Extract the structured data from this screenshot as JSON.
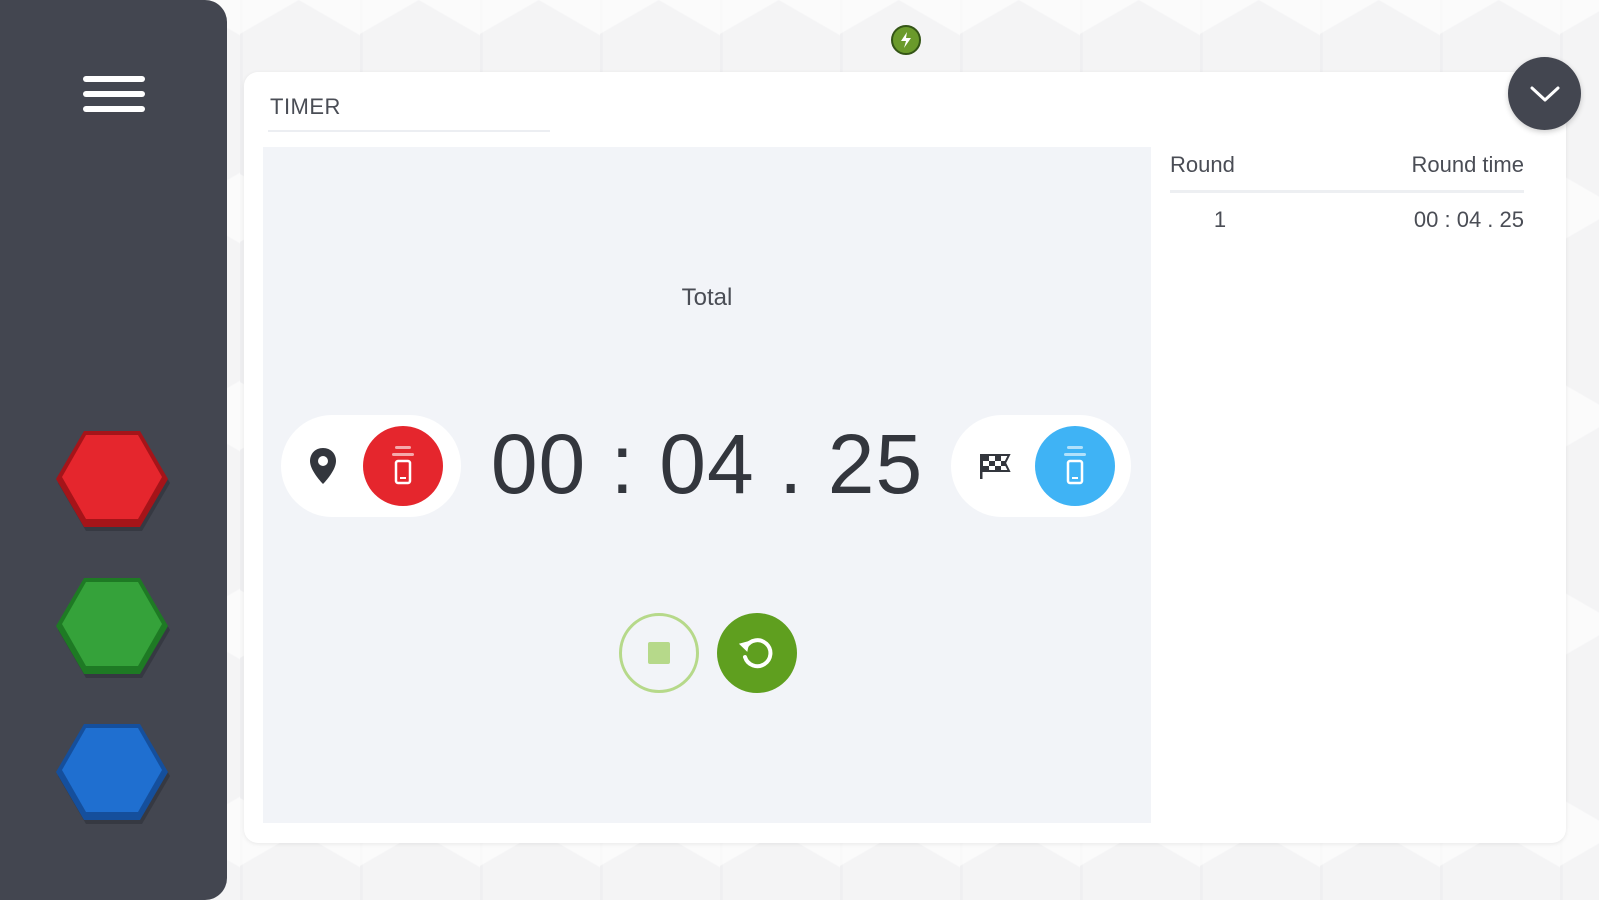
{
  "sidebar": {
    "menu_icon": "hamburger-menu-icon",
    "buttons": [
      {
        "name": "red-hex-button",
        "color": "#e5262d"
      },
      {
        "name": "green-hex-button",
        "color": "#35a23a"
      },
      {
        "name": "blue-hex-button",
        "color": "#1f6fd0"
      }
    ]
  },
  "status": {
    "indicator_color": "#6a9a2b",
    "icon": "lightning-icon"
  },
  "card": {
    "title": "TIMER",
    "collapse_icon": "chevron-down-icon"
  },
  "timer": {
    "total_label": "Total",
    "display": "00 : 04 . 25",
    "start_icon": "location-pin-icon",
    "start_device_color": "#e5262d",
    "finish_icon": "checkered-flag-icon",
    "finish_device_color": "#3fb3f5",
    "stop_icon": "stop-icon",
    "reset_icon": "reset-icon"
  },
  "rounds": {
    "columns": [
      "Round",
      "Round time"
    ],
    "rows": [
      {
        "round": "1",
        "time": "00 : 04 . 25"
      }
    ]
  }
}
